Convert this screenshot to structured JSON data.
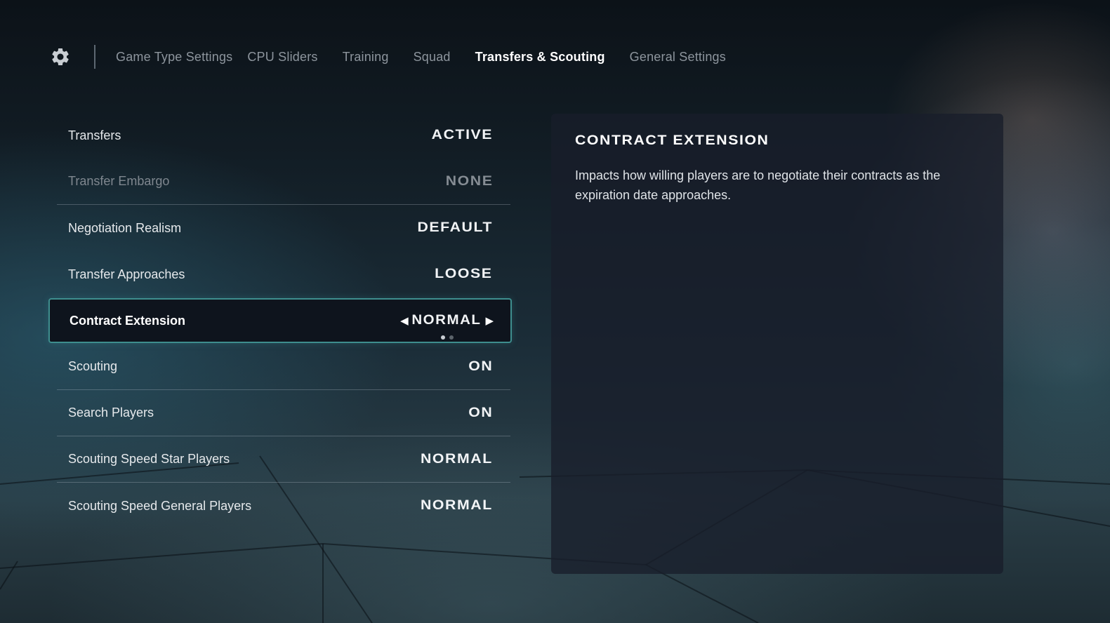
{
  "header": {
    "settings_icon": "gear-icon",
    "tabs": [
      {
        "label": "Game Type Settings",
        "active": false
      },
      {
        "label": "CPU Sliders",
        "active": false
      },
      {
        "label": "Training",
        "active": false
      },
      {
        "label": "Squad",
        "active": false
      },
      {
        "label": "Transfers & Scouting",
        "active": true
      },
      {
        "label": "General Settings",
        "active": false
      }
    ]
  },
  "settings": [
    {
      "label": "Transfers",
      "value": "ACTIVE"
    },
    {
      "label": "Transfer Embargo",
      "value": "NONE",
      "disabled": true
    },
    {
      "label": "Negotiation Realism",
      "value": "DEFAULT"
    },
    {
      "label": "Transfer Approaches",
      "value": "LOOSE"
    },
    {
      "label": "Contract Extension",
      "value": "NORMAL",
      "selected": true,
      "options_count": 2,
      "option_index": 1
    },
    {
      "label": "Scouting",
      "value": "ON"
    },
    {
      "label": "Search Players",
      "value": "ON"
    },
    {
      "label": "Scouting Speed Star Players",
      "value": "NORMAL"
    },
    {
      "label": "Scouting Speed General Players",
      "value": "NORMAL"
    }
  ],
  "selector_icons": {
    "left": "triangle-left-icon",
    "right": "triangle-right-icon"
  },
  "description": {
    "title": "CONTRACT EXTENSION",
    "body": "Impacts how willing players are to negotiate their contracts as the expiration date approaches."
  },
  "colors": {
    "accent_border": "#3e8e8e",
    "selected_bg": "#0e141d",
    "panel_bg": "#181e2a"
  }
}
